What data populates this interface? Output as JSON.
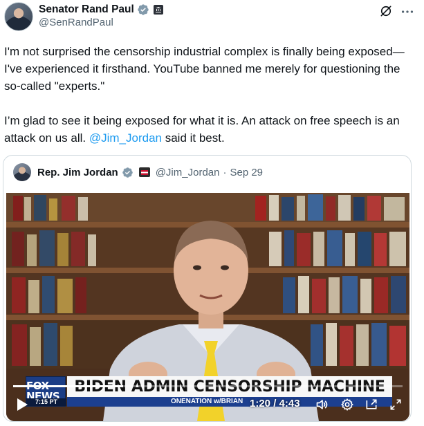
{
  "author": {
    "name": "Senator Rand Paul",
    "handle": "@SenRandPaul"
  },
  "tweet": {
    "paragraph1": "I'm not surprised the censorship industrial complex is finally being exposed—I've experienced it firsthand. YouTube banned me merely for questioning the so-called \"experts.\"",
    "paragraph2_before": "I’m glad to see it being exposed for what it is. An attack on free speech is an attack on us all. ",
    "mention": "@Jim_Jordan",
    "paragraph2_after": " said it best."
  },
  "quote": {
    "name": "Rep. Jim Jordan",
    "handle": "@Jim_Jordan",
    "separator": "·",
    "date": "Sep 29"
  },
  "video": {
    "network": "FOX NEWS",
    "network_time": "7:15 PT",
    "headline": "BIDEN ADMIN CENSORSHIP MACHINE",
    "lower_text": "ONENATION  w/BRIAN",
    "time_display": "1:20 / 4:43",
    "progress": 0.283
  },
  "colors": {
    "verified": "#1d9bf0",
    "mention": "#1d9bf0",
    "secondary_text": "#536471"
  },
  "icons": {
    "verified": "verified-badge-icon",
    "government": "government-label-icon",
    "grok": "grok-icon",
    "more": "more-icon",
    "play": "play-icon",
    "volume": "volume-icon",
    "settings": "settings-icon",
    "pip": "picture-in-picture-icon",
    "fullscreen": "fullscreen-icon"
  }
}
